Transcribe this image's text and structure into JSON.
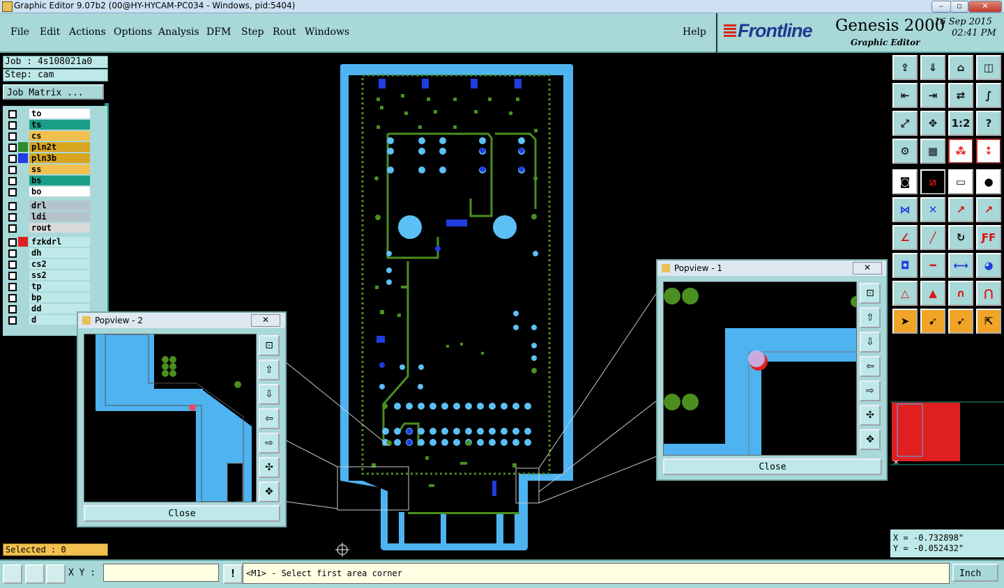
{
  "window": {
    "title": "Graphic Editor 9.07b2 (00@HY-HYCAM-PC034 - Windows, pid:5404)"
  },
  "menu": {
    "items": [
      "File",
      "Edit",
      "Actions",
      "Options",
      "Analysis",
      "DFM",
      "Step",
      "Rout",
      "Windows"
    ],
    "help": "Help"
  },
  "brand": {
    "logo": "Frontline",
    "product": "Genesis 2000",
    "subtitle": "Graphic Editor",
    "date": "16  Sep  2015",
    "time": "02:41  PM"
  },
  "job": {
    "job_label": "Job : 4s108021a0",
    "step_label": "Step: cam",
    "matrix_button": "Job Matrix ..."
  },
  "layers": [
    {
      "name": "to",
      "color": "#ffffff",
      "swatch": ""
    },
    {
      "name": "ts",
      "color": "#1a9e88",
      "swatch": ""
    },
    {
      "name": "cs",
      "color": "#f1c04f",
      "swatch": ""
    },
    {
      "name": "pln2t",
      "color": "#d9a520",
      "swatch": "#2e8b2e"
    },
    {
      "name": "pln3b",
      "color": "#d9a520",
      "swatch": "#1f3de0"
    },
    {
      "name": "ss",
      "color": "#f1c04f",
      "swatch": ""
    },
    {
      "name": "bs",
      "color": "#1a9e88",
      "swatch": ""
    },
    {
      "name": "bo",
      "color": "#ffffff",
      "swatch": ""
    },
    {
      "name": "drl",
      "color": "#b5c4cc",
      "swatch": ""
    },
    {
      "name": "ldi",
      "color": "#b5c4cc",
      "swatch": ""
    },
    {
      "name": "rout",
      "color": "#d9d9d9",
      "swatch": ""
    },
    {
      "name": "fzkdrl",
      "color": "#bfe9e9",
      "swatch": "#e02020"
    },
    {
      "name": "dh",
      "color": "#bfe9e9",
      "swatch": ""
    },
    {
      "name": "cs2",
      "color": "#bfe9e9",
      "swatch": ""
    },
    {
      "name": "ss2",
      "color": "#bfe9e9",
      "swatch": ""
    },
    {
      "name": "tp",
      "color": "#bfe9e9",
      "swatch": ""
    },
    {
      "name": "bp",
      "color": "#bfe9e9",
      "swatch": ""
    },
    {
      "name": "dd",
      "color": "#bfe9e9",
      "swatch": ""
    },
    {
      "name": "d",
      "color": "#bfe9e9",
      "swatch": ""
    }
  ],
  "status": {
    "selected": "Selected : 0",
    "xy_label": "X Y :",
    "xy_value": "",
    "prompt": "<M1> - Select first area corner",
    "units": "Inch"
  },
  "coords": {
    "x": "X = -0.732898\"",
    "y": "Y = -0.052432\""
  },
  "popview1": {
    "title": "Popview - 1",
    "close": "Close"
  },
  "popview2": {
    "title": "Popview - 2",
    "close": "Close"
  },
  "colors": {
    "panel": "#a8d8d8",
    "board_outline": "#4fb3f0",
    "copper": "#4a8f1f",
    "pads": "#5cc0f5",
    "drill": "#1f3de0",
    "highlight": "#e02020"
  }
}
